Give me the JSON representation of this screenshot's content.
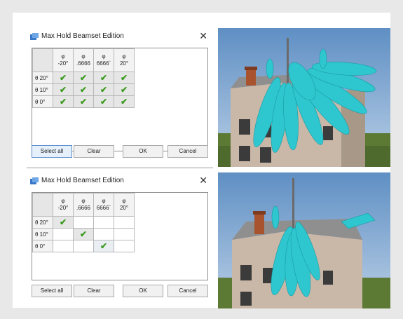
{
  "dialogs": [
    {
      "title": "Max Hold Beamset Edition",
      "close_glyph": "✕",
      "columns": [
        {
          "label": "φ",
          "value": "-20°"
        },
        {
          "label": "φ",
          "value": ".6666"
        },
        {
          "label": "φ",
          "value": "6666`"
        },
        {
          "label": "φ",
          "value": "20°"
        }
      ],
      "rows": [
        "θ 20°",
        "θ 10°",
        "θ 0°"
      ],
      "checked": [
        [
          true,
          true,
          true,
          true
        ],
        [
          true,
          true,
          true,
          true
        ],
        [
          true,
          true,
          true,
          true
        ]
      ],
      "buttons": {
        "select_all": "Select all",
        "clear": "Clear",
        "ok": "OK",
        "cancel": "Cancel"
      }
    },
    {
      "title": "Max Hold Beamset Edition",
      "close_glyph": "✕",
      "columns": [
        {
          "label": "φ",
          "value": "-20°"
        },
        {
          "label": "φ",
          "value": ".6666"
        },
        {
          "label": "φ",
          "value": "6666`"
        },
        {
          "label": "φ",
          "value": "20°"
        }
      ],
      "rows": [
        "θ 20°",
        "θ 10°",
        "θ 0°"
      ],
      "checked": [
        [
          true,
          false,
          false,
          false
        ],
        [
          false,
          true,
          false,
          false
        ],
        [
          false,
          false,
          true,
          false
        ]
      ],
      "buttons": {
        "select_all": "Select all",
        "clear": "Clear",
        "ok": "OK",
        "cancel": "Cancel"
      }
    }
  ],
  "check_glyph": "✔",
  "colors": {
    "check": "#3a9a1e",
    "beam": "#2ec7cf",
    "sky": "#7fa6cf",
    "grass": "#5d7a35"
  },
  "icons": {
    "window": "app-window-icon",
    "close": "close-icon",
    "check": "checkmark-icon"
  }
}
